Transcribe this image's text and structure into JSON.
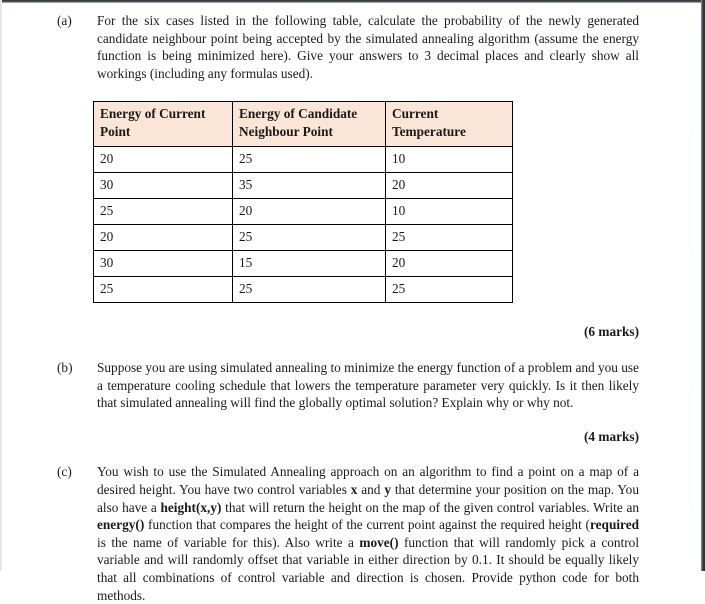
{
  "document": {
    "type": "exam-question-sheet",
    "background_color": "#ffffff",
    "text_color": "#1a1a1a",
    "table_header_color": "#fbe5d6"
  },
  "questions": [
    {
      "label": "(a)",
      "text_parts": [
        {
          "text": "For the six cases listed in the following table, calculate the probability of the newly generated candidate neighbour point being accepted by the simulated annealing algorithm (assume the energy function is being minimized here). Give your answers to 3 decimal places and clearly show all workings (including any formulas used).",
          "bold": false
        }
      ],
      "marks": "(6 marks)"
    },
    {
      "label": "(b)",
      "text_parts": [
        {
          "text": "Suppose you are using simulated annealing to minimize the energy function of a problem and you use a temperature cooling schedule that lowers the temperature parameter very quickly. Is it then likely that simulated annealing will find the globally optimal solution? Explain why or why not.",
          "bold": false
        }
      ],
      "marks": "(4 marks)"
    },
    {
      "label": "(c)",
      "text_parts": [
        {
          "text": "You wish to use the Simulated Annealing approach on an algorithm to find a point on a map of a desired height. You have two control variables ",
          "bold": false
        },
        {
          "text": "x",
          "bold": true
        },
        {
          "text": " and ",
          "bold": false
        },
        {
          "text": "y",
          "bold": true
        },
        {
          "text": " that determine your position on the map. You also have a ",
          "bold": false
        },
        {
          "text": "height(x,y)",
          "bold": true
        },
        {
          "text": " that will return the height on the map of the given control variables. Write an ",
          "bold": false
        },
        {
          "text": "energy()",
          "bold": true
        },
        {
          "text": " function that compares the height of the current point against the required height (",
          "bold": false
        },
        {
          "text": "required",
          "bold": true
        },
        {
          "text": " is the name of variable for this). Also write a ",
          "bold": false
        },
        {
          "text": "move()",
          "bold": true
        },
        {
          "text": " function that will randomly pick a control variable and will randomly offset that variable in either direction by 0.1. It should be equally likely that all combinations of control variable and direction is chosen. Provide python code for both methods.",
          "bold": false
        }
      ],
      "marks": ""
    }
  ],
  "table": {
    "headers": [
      "Energy of Current Point",
      "Energy of Candidate Neighbour Point",
      "Current Temperature"
    ],
    "rows": [
      [
        "20",
        "25",
        "10"
      ],
      [
        "30",
        "35",
        "20"
      ],
      [
        "25",
        "20",
        "10"
      ],
      [
        "20",
        "25",
        "25"
      ],
      [
        "30",
        "15",
        "20"
      ],
      [
        "25",
        "25",
        "25"
      ]
    ]
  }
}
